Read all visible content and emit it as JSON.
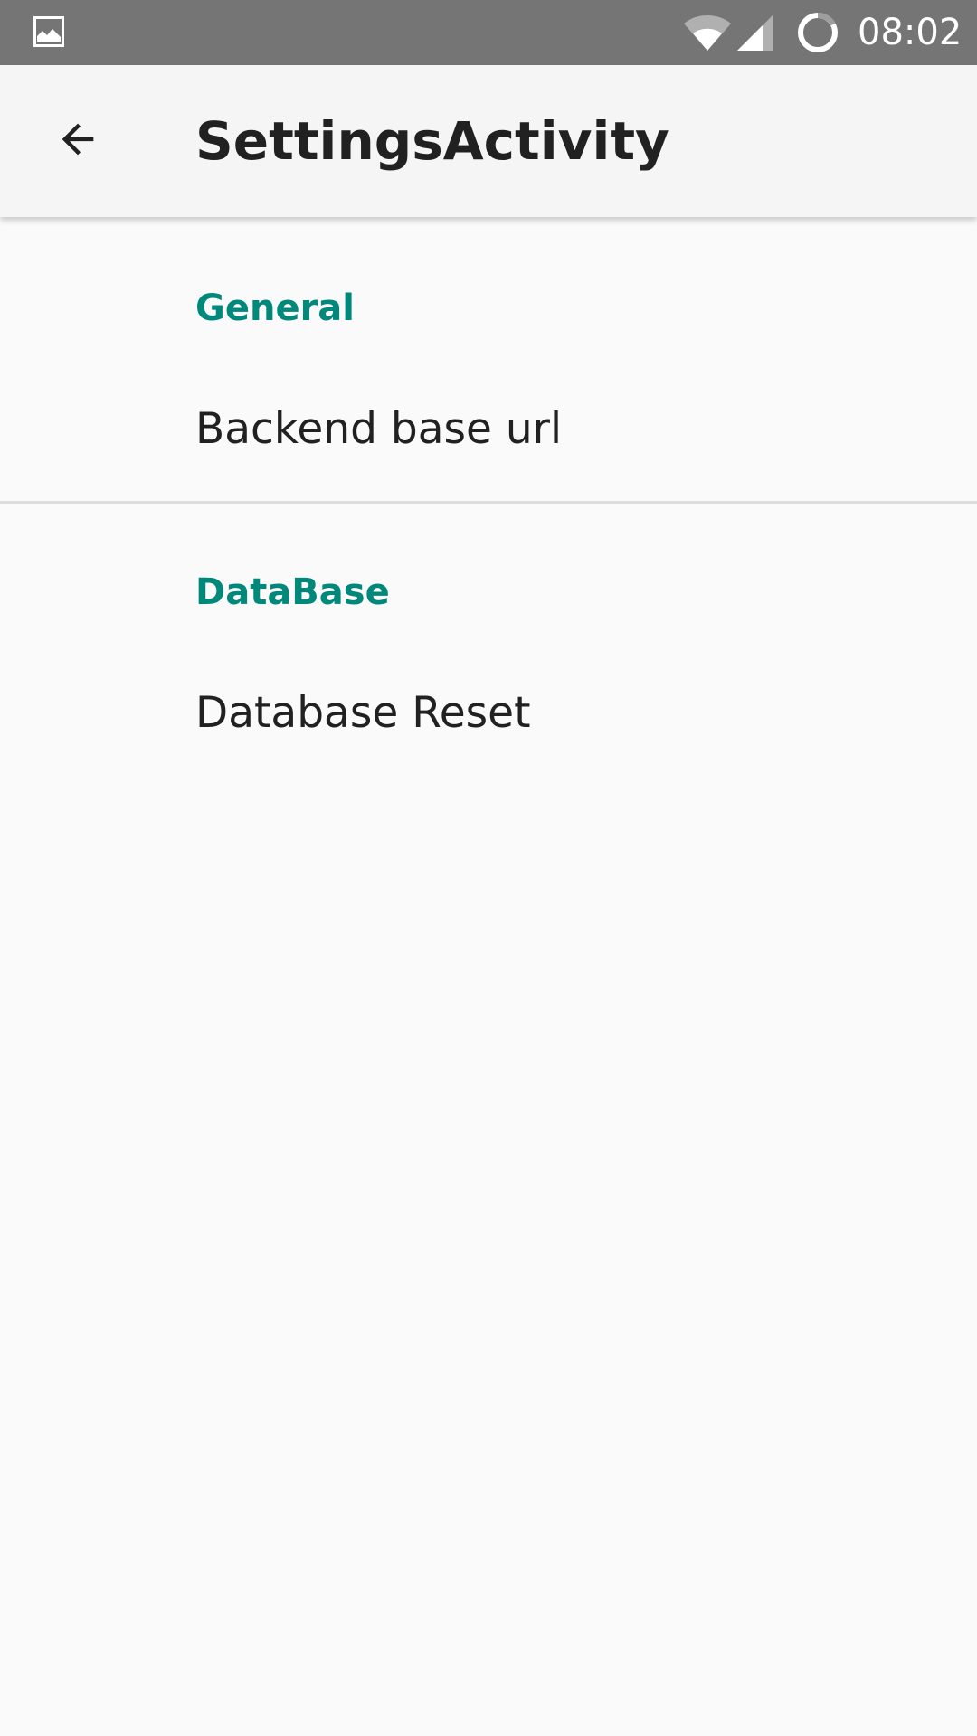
{
  "status_bar": {
    "time": "08:02",
    "left_icon": "image-notification-icon",
    "wifi_icon": "wifi-icon",
    "signal_icon": "cell-signal-icon",
    "battery_icon": "battery-charging-icon"
  },
  "app_bar": {
    "title": "SettingsActivity",
    "back_icon": "arrow-back-icon"
  },
  "preferences": {
    "general": {
      "header": "General",
      "items": [
        {
          "title": "Backend base url"
        }
      ]
    },
    "database": {
      "header": "DataBase",
      "items": [
        {
          "title": "Database Reset"
        }
      ]
    }
  },
  "colors": {
    "status_bar": "#757575",
    "app_bar": "#f5f5f5",
    "background": "#fafafa",
    "accent": "#00897b",
    "text_primary": "#212121",
    "divider": "#dcdcdc"
  }
}
